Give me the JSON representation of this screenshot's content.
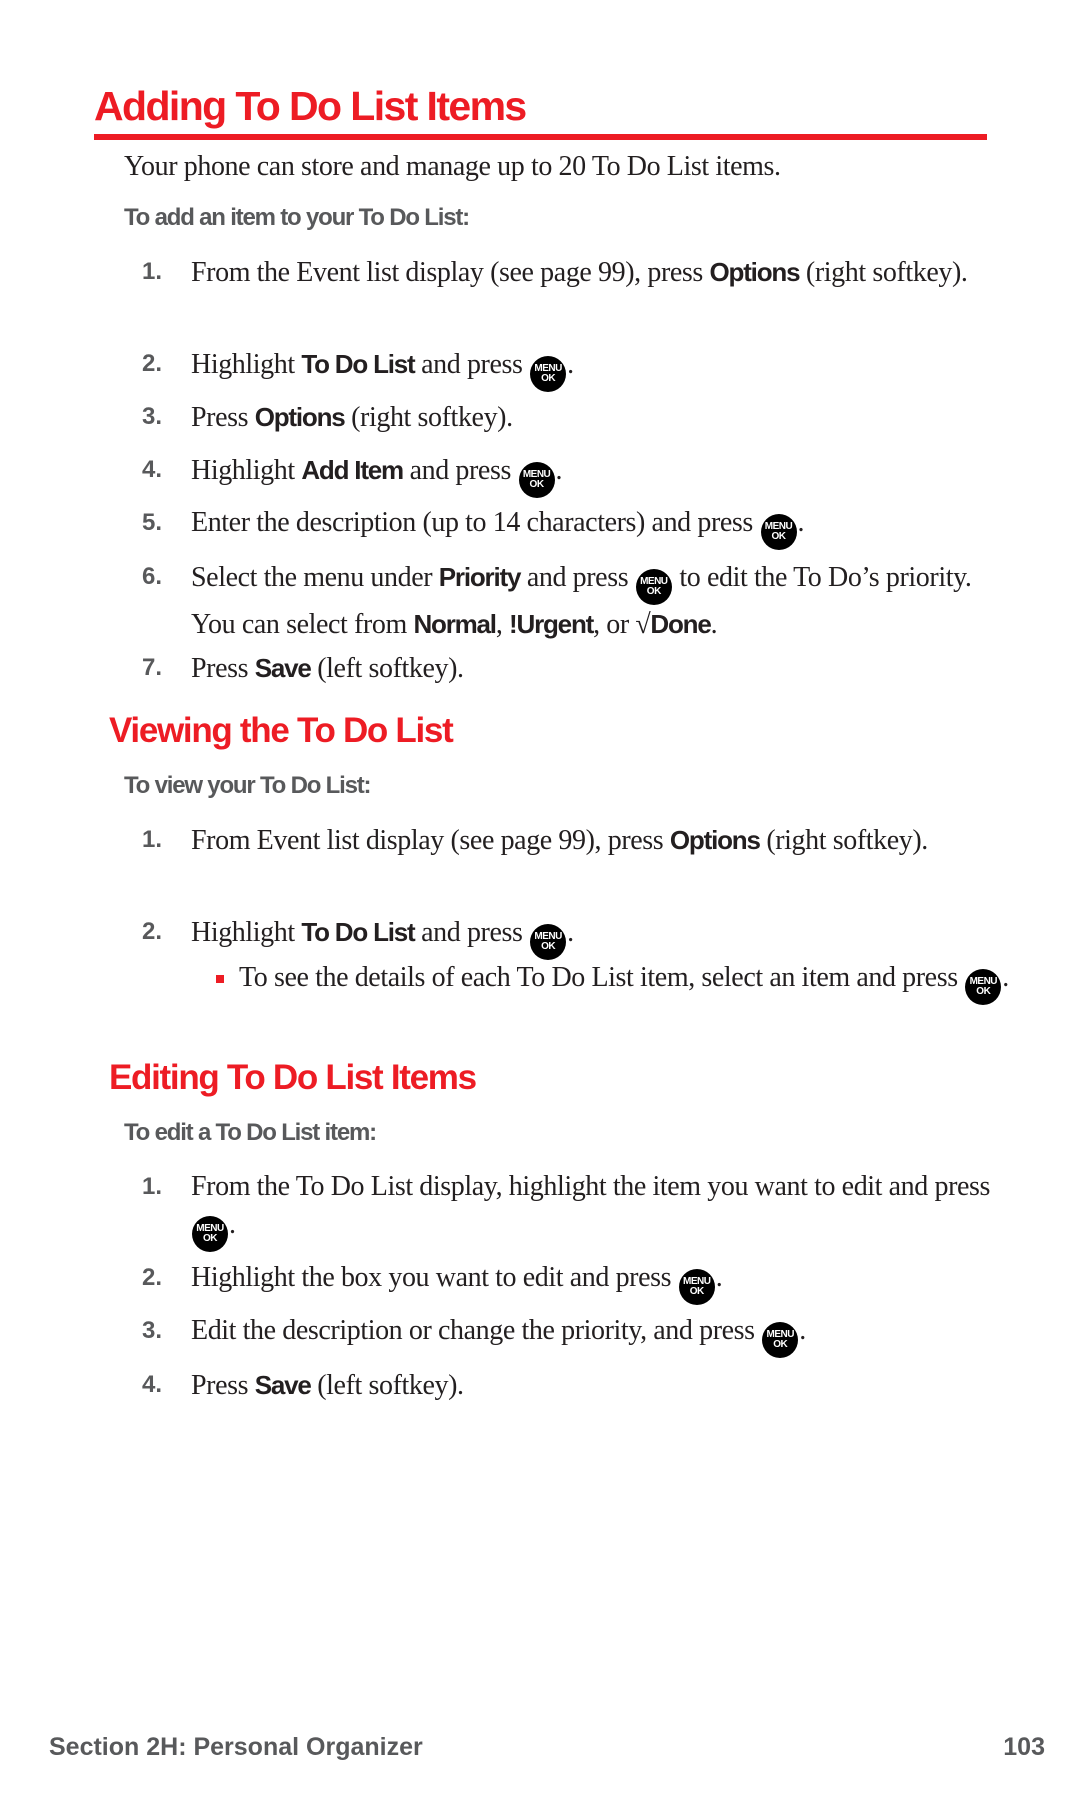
{
  "page": {
    "title": "Adding To Do List Items",
    "intro": "Your phone can store and manage up to 20 To Do List items.",
    "icons": {
      "menu_ok": {
        "name": "menu-ok-key-icon",
        "line1": "MENU",
        "line2": "OK"
      }
    },
    "colors": {
      "accent": "#ed1c24",
      "subhead_gray": "#58595b",
      "body_text": "#231f20"
    }
  },
  "sections": [
    {
      "heading": "",
      "subheading": "To add an item to your To Do List:",
      "steps": [
        {
          "num": "1.",
          "parts": [
            "From the Event list display (see page 99), press ",
            "Options",
            " (right softkey)."
          ]
        },
        {
          "num": "2.",
          "parts": [
            "Highlight ",
            "To Do List",
            " and press ",
            "."
          ]
        },
        {
          "num": "3.",
          "parts": [
            "Press ",
            "Options",
            " (right softkey)."
          ]
        },
        {
          "num": "4.",
          "parts": [
            "Highlight ",
            "Add Item",
            " and press ",
            "."
          ]
        },
        {
          "num": "5.",
          "parts": [
            "Enter the description (up to 14 characters) and press ",
            "."
          ]
        },
        {
          "num": "6.",
          "parts": [
            "Select the menu under ",
            "Priority",
            " and press ",
            " to edit the To Do’s priority. You can select from ",
            "Normal",
            ", ",
            "!Urgent",
            ", or √",
            "Done",
            "."
          ]
        },
        {
          "num": "7.",
          "parts": [
            "Press ",
            "Save",
            " (left softkey)."
          ]
        }
      ]
    },
    {
      "heading": "Viewing the To Do List",
      "subheading": "To view your To Do List:",
      "steps": [
        {
          "num": "1.",
          "parts": [
            "From Event list display (see page 99), press ",
            "Options",
            " (right softkey)."
          ]
        },
        {
          "num": "2.",
          "parts": [
            "Highlight ",
            "To Do List",
            " and press ",
            "."
          ]
        }
      ],
      "bullets": [
        {
          "parts": [
            "To see the details of each To Do List item, select an item and press ",
            "."
          ]
        }
      ]
    },
    {
      "heading": "Editing To Do List Items",
      "subheading": "To edit a To Do List item:",
      "steps": [
        {
          "num": "1.",
          "parts": [
            "From the To Do List display, highlight the item you want to edit and press ",
            "."
          ]
        },
        {
          "num": "2.",
          "parts": [
            "Highlight the box you want to edit and press ",
            "."
          ]
        },
        {
          "num": "3.",
          "parts": [
            "Edit the description or change the priority, and press ",
            "."
          ]
        },
        {
          "num": "4.",
          "parts": [
            "Press ",
            "Save",
            " (left softkey)."
          ]
        }
      ]
    }
  ],
  "footer": {
    "section": "Section 2H: Personal Organizer",
    "page_number": "103"
  }
}
